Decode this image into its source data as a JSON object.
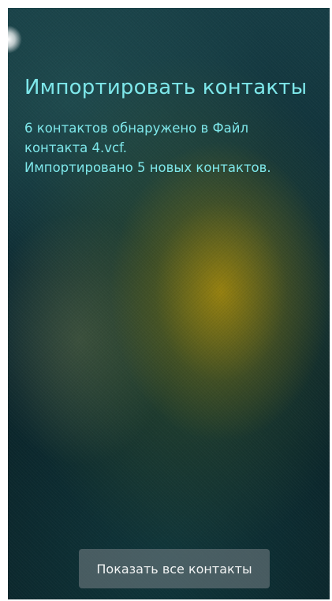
{
  "dialog": {
    "title": "Импортировать контакты",
    "message_lines": [
      "6 контактов обнаружено в Файл",
      "контакта 4.vcf.",
      "Импортировано 5 новых контактов."
    ]
  },
  "actions": {
    "show_all_label": "Показать все контакты"
  },
  "colors": {
    "accent_text": "#7ee7ea",
    "button_text": "#f2f4f4"
  }
}
